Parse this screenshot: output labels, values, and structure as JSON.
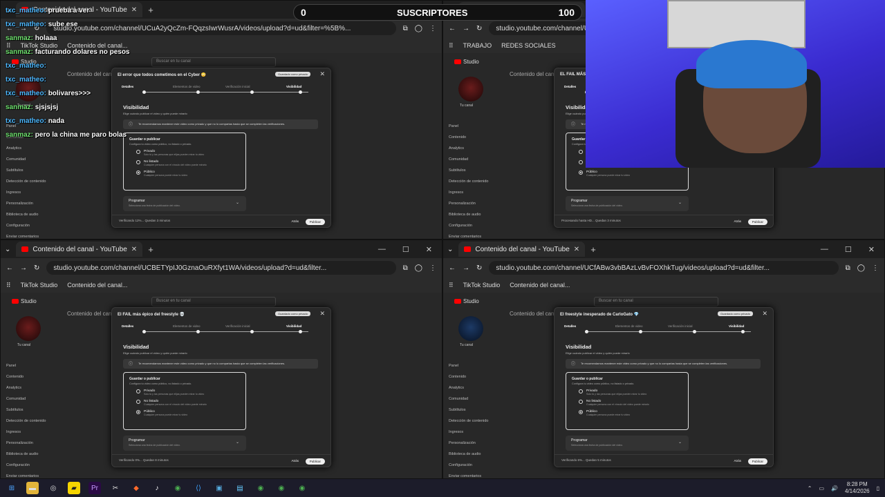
{
  "chat": [
    {
      "user": "txc_matheo:",
      "msg": "prueba a ver",
      "kind": "u1"
    },
    {
      "user": "txc_matheo:",
      "msg": "sube ese",
      "kind": "u1"
    },
    {
      "user": "sanmaz:",
      "msg": "holaaa",
      "kind": "u2"
    },
    {
      "user": "sanmaz:",
      "msg": "facturando dolares no pesos",
      "kind": "u2"
    },
    {
      "user": "txc_matheo:",
      "msg": "",
      "kind": "u1"
    },
    {
      "user": "txc_matheo:",
      "msg": "",
      "kind": "u1"
    },
    {
      "user": "txc_matheo:",
      "msg": "bolivares>>>",
      "kind": "u1"
    },
    {
      "user": "sanmaz:",
      "msg": "sjsjsjsj",
      "kind": "u2"
    },
    {
      "user": "txc_matheo:",
      "msg": "nada",
      "kind": "u1"
    },
    {
      "user": "sanmaz:",
      "msg": "pero la china me paro bolas",
      "kind": "u2"
    }
  ],
  "counter": {
    "left": "0",
    "label": "SUSCRIPTORES",
    "right": "100"
  },
  "windows": [
    {
      "tab": "Contenido del canal - YouTube",
      "url": "studio.youtube.com/channel/UCuA2yQcZm-FQqzsIwrWusrA/videos/upload?d=ud&filter=%5B%...",
      "bookmarks": [
        "TikTok Studio",
        "Contenido del canal..."
      ],
      "dialog_title": "El error que todos cometimos en el Cyber 😳",
      "footer": "Verificando 12%... Quedan 3 minutos",
      "avatar": "red"
    },
    {
      "tab": "Contenido del canal - YouTube",
      "url": "studio.youtube.com/channel/UC...",
      "bookmarks": [
        "TRABAJO",
        "REDES SOCIALES"
      ],
      "dialog_title": "EL FAIL MÁS ÉPICO",
      "footer": "Procesando hasta HD... Quedan 3 minutos",
      "avatar": "red"
    },
    {
      "tab": "Contenido del canal - YouTube",
      "url": "studio.youtube.com/channel/UCBETYpIJ0GznaOuRXfyt1WA/videos/upload?d=ud&filter...",
      "bookmarks": [
        "TikTok Studio",
        "Contenido del canal..."
      ],
      "dialog_title": "El FAIL más épico del freestyle 💀",
      "footer": "Verificando 0%... Quedan 8 minutos",
      "avatar": "red"
    },
    {
      "tab": "Contenido del canal - YouTube",
      "url": "studio.youtube.com/channel/UCfABw3vbBAzLvBvFOXhkTug/videos/upload?d=ud&filter...",
      "bookmarks": [
        "TikTok Studio",
        "Contenido del canal..."
      ],
      "dialog_title": "El freestyle inesperado de CarloGato 💎",
      "footer": "Verificando 6%... Quedan 5 minutos",
      "avatar": "blue"
    }
  ],
  "studio": {
    "logo": "Studio",
    "search": "Buscar en tu canal",
    "channel": "Tu canal",
    "main_title": "Contenido del canal",
    "side_items": [
      "Panel",
      "Contenido",
      "Analytics",
      "Comunidad",
      "Subtítulos",
      "Detección de contenido",
      "Ingresos",
      "Personalización",
      "Biblioteca de audio",
      "Configuración",
      "Enviar comentarios"
    ],
    "saved_badge": "Guardado como privado",
    "steps": [
      "Detalles",
      "Elementos de video",
      "Verificación inicial",
      "Visibilidad"
    ],
    "visibility": "Visibilidad",
    "visibility_sub": "Elige cuándo publicar el video y quién puede mirarlo",
    "info": "Te recomendamos mantener este video como privado y que no lo compartas hasta que se completen las verificaciones.",
    "save_head": "Guardar o publicar",
    "save_sub": "Configura tu video como público, no listado o privado.",
    "options": [
      {
        "t": "Privado",
        "d": "Solo tú y las personas que elijas pueden mirar tu video",
        "on": false
      },
      {
        "t": "No listado",
        "d": "Cualquier persona con el vínculo del video puede mirarlo",
        "on": false
      },
      {
        "t": "Público",
        "d": "Cualquier persona puede mirar tu video",
        "on": true
      }
    ],
    "program_t": "Programar",
    "program_d": "Selecciona una fecha de publicación del video.",
    "guardar": "Atrás",
    "publicar": "Publicar"
  },
  "taskbar": {
    "time": "8:28 PM",
    "date": "4/14/2026"
  }
}
